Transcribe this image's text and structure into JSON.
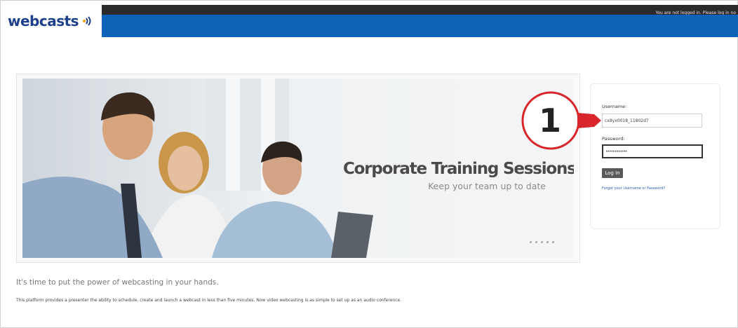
{
  "header": {
    "logo_text": "webcasts",
    "login_status": "You are not logged in. Please log in no"
  },
  "hero": {
    "title": "Corporate Training Sessions",
    "subtitle": "Keep your team up to date",
    "dots_count": 5
  },
  "login": {
    "username_label": "Username:",
    "username_value": "cx8yx0018_11802d7",
    "password_label": "Password:",
    "password_value": "••••••••••••",
    "button_label": "Log In",
    "forgot_link": "Forgot your Username or Password?"
  },
  "callout": {
    "number": "1",
    "color": "#d9262c"
  },
  "body": {
    "tagline": "It's time to put the power of webcasting in your hands.",
    "description": "This platform provides a presenter the ability to schedule, create and launch a webcast in less than five minutes. Now video webcasting is as simple to set up as an audio conference."
  },
  "colors": {
    "brand_blue": "#0d63b8",
    "dark_bar": "#2b2b2b",
    "logo": "#1e3f8a"
  }
}
